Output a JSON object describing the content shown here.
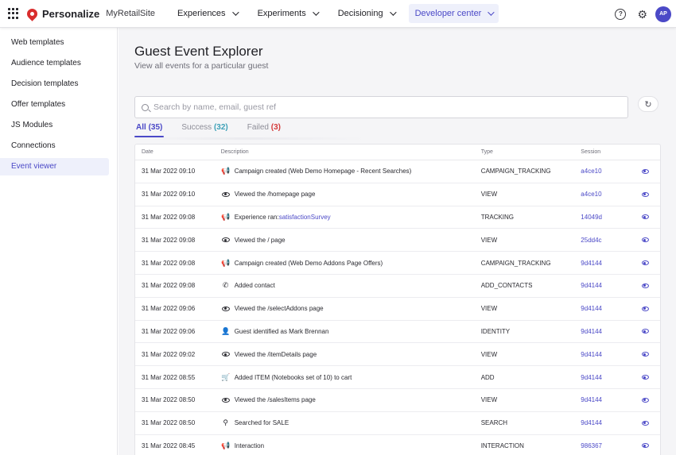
{
  "header": {
    "brand": "Personalize",
    "site": "MyRetailSite",
    "nav": [
      {
        "label": "Experiences"
      },
      {
        "label": "Experiments"
      },
      {
        "label": "Decisioning"
      },
      {
        "label": "Developer center"
      }
    ],
    "help_icon": "question-circle-icon",
    "settings_icon": "gear-icon",
    "avatar_initials": "AP"
  },
  "sidebar": {
    "items": [
      {
        "label": "Web templates"
      },
      {
        "label": "Audience templates"
      },
      {
        "label": "Decision templates"
      },
      {
        "label": "Offer templates"
      },
      {
        "label": "JS Modules"
      },
      {
        "label": "Connections"
      },
      {
        "label": "Event viewer"
      }
    ],
    "active": "Event viewer"
  },
  "main": {
    "title": "Guest Event Explorer",
    "subtitle": "View all events for a particular guest",
    "search": {
      "placeholder": "Search by name, email, guest ref",
      "value": ""
    },
    "tabs": [
      {
        "label": "All",
        "count": "(35)"
      },
      {
        "label": "Success",
        "count": "(32)"
      },
      {
        "label": "Failed",
        "count": "(3)"
      }
    ],
    "table": {
      "columns": {
        "date": "Date",
        "description": "Description",
        "type": "Type",
        "session": "Session"
      },
      "rows": [
        {
          "date": "31 Mar 2022 09:10",
          "icon": "megaphone-icon",
          "description": "Campaign created (Web Demo Homepage - Recent Searches)",
          "link": "",
          "type": "CAMPAIGN_TRACKING",
          "session": "a4ce10"
        },
        {
          "date": "31 Mar 2022 09:10",
          "icon": "eye-icon",
          "description": "Viewed the /homepage page",
          "link": "",
          "type": "VIEW",
          "session": "a4ce10"
        },
        {
          "date": "31 Mar 2022 09:08",
          "icon": "megaphone-icon",
          "description": "Experience ran: ",
          "link": "satisfactionSurvey",
          "type": "TRACKING",
          "session": "14049d"
        },
        {
          "date": "31 Mar 2022 09:08",
          "icon": "eye-icon",
          "description": "Viewed the / page",
          "link": "",
          "type": "VIEW",
          "session": "25dd4c"
        },
        {
          "date": "31 Mar 2022 09:08",
          "icon": "megaphone-icon",
          "description": "Campaign created (Web Demo Addons Page Offers)",
          "link": "",
          "type": "CAMPAIGN_TRACKING",
          "session": "9d4144"
        },
        {
          "date": "31 Mar 2022 09:08",
          "icon": "phone-icon",
          "description": "Added contact",
          "link": "",
          "type": "ADD_CONTACTS",
          "session": "9d4144"
        },
        {
          "date": "31 Mar 2022 09:06",
          "icon": "eye-icon",
          "description": "Viewed the /selectAddons page",
          "link": "",
          "type": "VIEW",
          "session": "9d4144"
        },
        {
          "date": "31 Mar 2022 09:06",
          "icon": "person-icon",
          "description": "Guest identified as Mark Brennan",
          "link": "",
          "type": "IDENTITY",
          "session": "9d4144"
        },
        {
          "date": "31 Mar 2022 09:02",
          "icon": "eye-icon",
          "description": "Viewed the /itemDetails page",
          "link": "",
          "type": "VIEW",
          "session": "9d4144"
        },
        {
          "date": "31 Mar 2022 08:55",
          "icon": "cart-icon",
          "description": "Added ITEM (Notebooks set of 10) to cart",
          "link": "",
          "type": "ADD",
          "session": "9d4144"
        },
        {
          "date": "31 Mar 2022 08:50",
          "icon": "eye-icon",
          "description": "Viewed the /salesItems page",
          "link": "",
          "type": "VIEW",
          "session": "9d4144"
        },
        {
          "date": "31 Mar 2022 08:50",
          "icon": "search-icon",
          "description": "Searched for SALE",
          "link": "",
          "type": "SEARCH",
          "session": "9d4144"
        },
        {
          "date": "31 Mar 2022 08:45",
          "icon": "megaphone-icon",
          "description": "Interaction",
          "link": "",
          "type": "INTERACTION",
          "session": "986367"
        }
      ]
    }
  },
  "colors": {
    "accent": "#4b49c7",
    "success": "#3ea1b8",
    "failed": "#d43b3b",
    "brand": "#d92d2d"
  }
}
